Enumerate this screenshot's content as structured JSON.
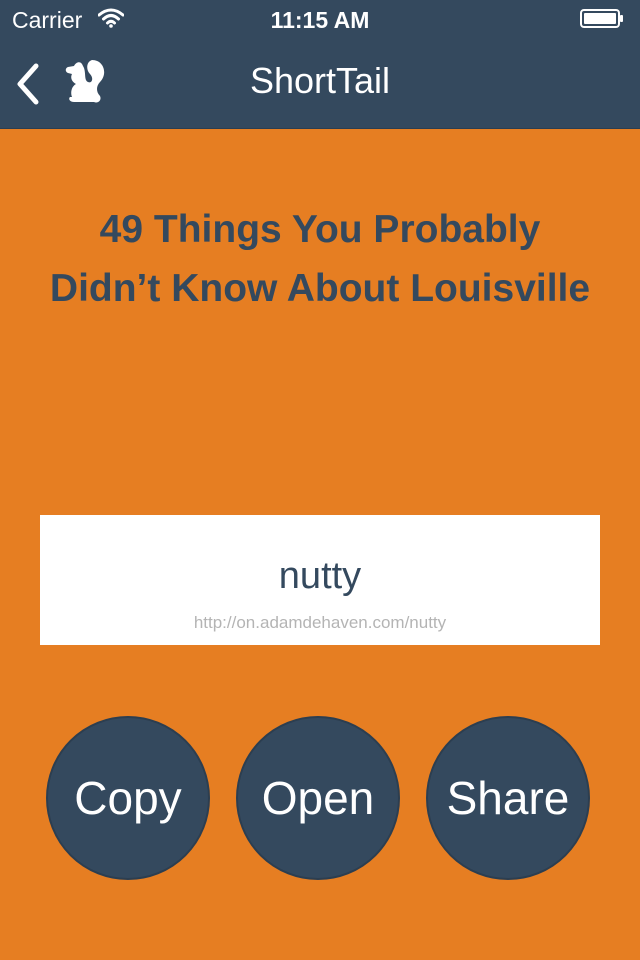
{
  "status_bar": {
    "carrier": "Carrier",
    "time": "11:15 AM",
    "icons": [
      "wifi-icon",
      "battery-icon"
    ]
  },
  "nav": {
    "back_icon": "chevron-left-icon",
    "logo_icon": "squirrel-logo-icon",
    "title": "ShortTail"
  },
  "main": {
    "headline": "49 Things You Probably Didn’t Know About Louisville",
    "link": {
      "slug": "nutty",
      "url": "http://on.adamdehaven.com/nutty"
    },
    "actions": {
      "copy_label": "Copy",
      "open_label": "Open",
      "share_label": "Share"
    }
  },
  "colors": {
    "background": "#e67e22",
    "bar": "#34495e",
    "text_dark": "#34495e",
    "card": "#ffffff",
    "url_gray": "#b4b4b4"
  }
}
